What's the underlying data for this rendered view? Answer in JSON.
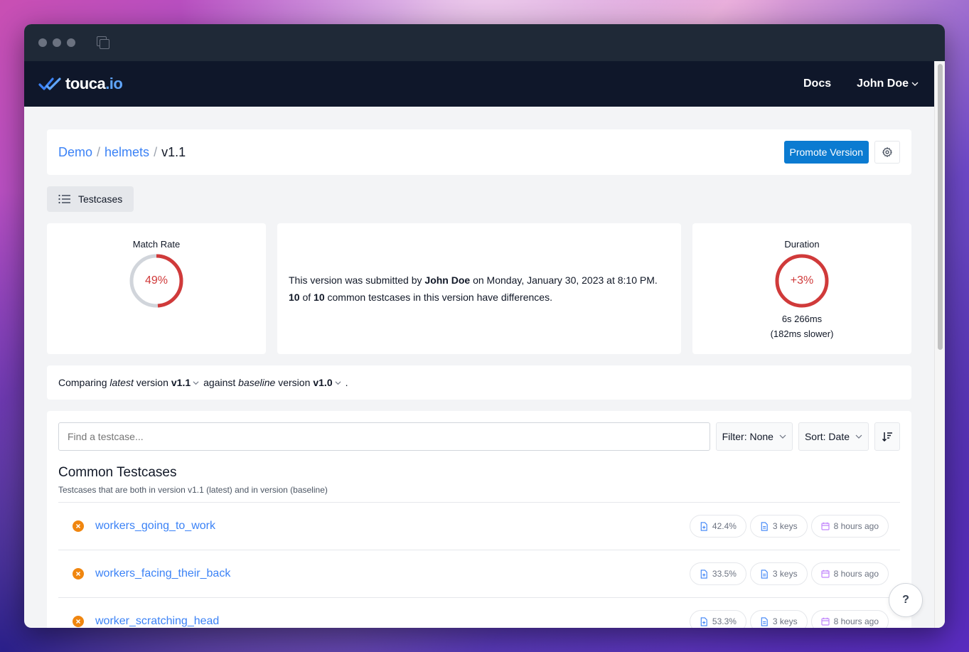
{
  "app": {
    "brand_name": "touca",
    "brand_tld": ".io",
    "nav_docs": "Docs",
    "nav_user": "John Doe"
  },
  "breadcrumb": {
    "team": "Demo",
    "suite": "helmets",
    "version": "v1.1",
    "sep": "/"
  },
  "actions": {
    "promote_label": "Promote Version"
  },
  "tabs": {
    "testcases_label": "Testcases"
  },
  "stats": {
    "match_rate_title": "Match Rate",
    "match_rate_value": "49%",
    "match_rate_fraction": 0.49,
    "submission": {
      "prefix": "This version was submitted by",
      "user": "John Doe",
      "date_text": "on Monday, January 30, 2023 at 8:10 PM.",
      "diff_count": "10",
      "of_text": "of",
      "total_count": "10",
      "diff_suffix": "common testcases in this version have differences."
    },
    "duration_title": "Duration",
    "duration_change": "+3%",
    "duration_value": "6s 266ms",
    "duration_delta": "(182ms slower)"
  },
  "compare": {
    "prefix": "Comparing",
    "latest_word": "latest",
    "version_word": "version",
    "latest_version": "v1.1",
    "against": "against",
    "baseline_word": "baseline",
    "version_word2": "version",
    "baseline_version": "v1.0",
    "period": "."
  },
  "list": {
    "search_placeholder": "Find a testcase...",
    "filter_label": "Filter: None",
    "sort_label": "Sort: Date",
    "section_title": "Common Testcases",
    "section_subtitle": "Testcases that are both in version v1.1 (latest) and in version (baseline)",
    "rows": [
      {
        "name": "workers_going_to_work",
        "match": "42.4%",
        "keys": "3 keys",
        "time": "8 hours ago"
      },
      {
        "name": "workers_facing_their_back",
        "match": "33.5%",
        "keys": "3 keys",
        "time": "8 hours ago"
      },
      {
        "name": "worker_scratching_head",
        "match": "53.3%",
        "keys": "3 keys",
        "time": "8 hours ago"
      }
    ]
  },
  "help_label": "?",
  "colors": {
    "accent": "#0b7bd1",
    "link": "#3b82f6",
    "danger": "#d03a3a",
    "warning": "#f0860f",
    "navbar": "#0f172a"
  },
  "icons": {
    "brand": "double-check-icon",
    "user_menu": "chevron-down-icon",
    "settings": "gear-icon",
    "testcases": "list-icon",
    "sort_direction": "sort-descending-icon",
    "status": "x-circle-icon",
    "match": "file-plus-icon",
    "keys": "document-icon",
    "time": "calendar-icon"
  }
}
